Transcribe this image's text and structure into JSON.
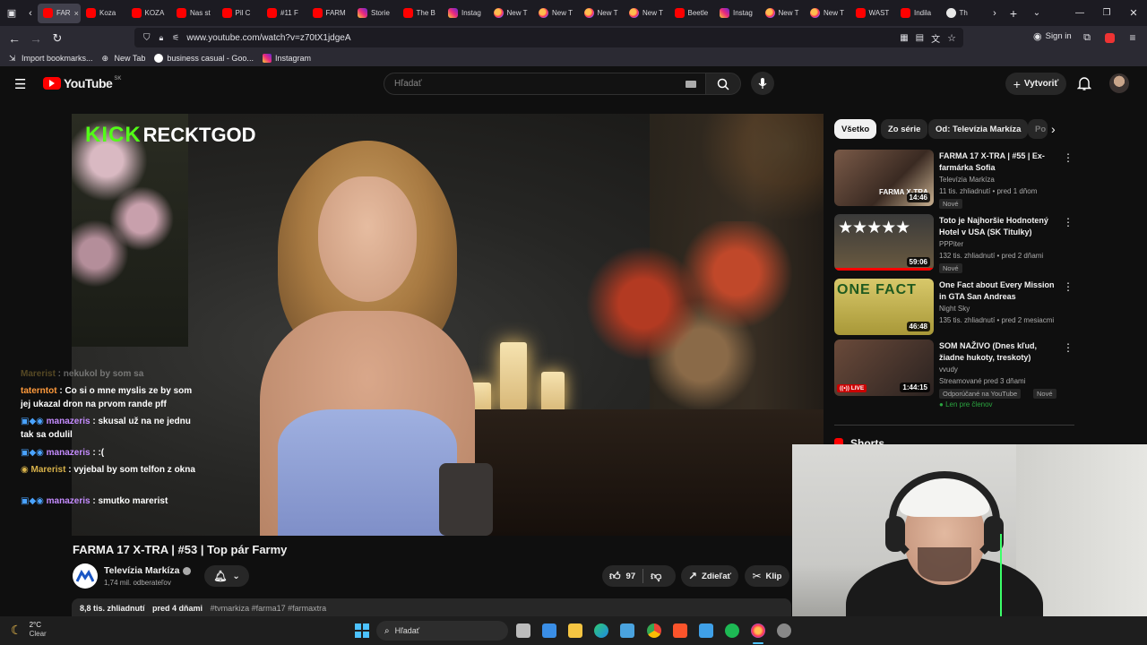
{
  "browser": {
    "tabs": [
      {
        "label": "FAR",
        "favicon": "youtube",
        "active": true
      },
      {
        "label": "Koza",
        "favicon": "youtube"
      },
      {
        "label": "KOZA",
        "favicon": "youtube"
      },
      {
        "label": "Nas st",
        "favicon": "youtube"
      },
      {
        "label": "Pil C",
        "favicon": "youtube"
      },
      {
        "label": "#11 F",
        "favicon": "youtube"
      },
      {
        "label": "FARM",
        "favicon": "youtube"
      },
      {
        "label": "Storie",
        "favicon": "instagram"
      },
      {
        "label": "The B",
        "favicon": "youtube"
      },
      {
        "label": "Instag",
        "favicon": "instagram"
      },
      {
        "label": "New T",
        "favicon": "new-tab"
      },
      {
        "label": "New T",
        "favicon": "new-tab"
      },
      {
        "label": "New T",
        "favicon": "new-tab"
      },
      {
        "label": "New T",
        "favicon": "new-tab"
      },
      {
        "label": "Beetle",
        "favicon": "youtube"
      },
      {
        "label": "Instag",
        "favicon": "instagram"
      },
      {
        "label": "New T",
        "favicon": "new-tab"
      },
      {
        "label": "New T",
        "favicon": "new-tab"
      },
      {
        "label": "WAST",
        "favicon": "youtube"
      },
      {
        "label": "Indila",
        "favicon": "youtube"
      },
      {
        "label": "Th",
        "favicon": "other"
      }
    ],
    "tab_close": "×",
    "url": "www.youtube.com/watch?v=z70tX1jdgeA",
    "sign_in": "Sign in",
    "bookmarks": [
      {
        "label": "Import bookmarks...",
        "icon": "import-icon"
      },
      {
        "label": "New Tab",
        "icon": "globe-icon"
      },
      {
        "label": "business casual - Goo...",
        "icon": "google-icon"
      },
      {
        "label": "Instagram",
        "icon": "instagram-icon"
      }
    ]
  },
  "youtube": {
    "logo_text": "YouTube",
    "region": "SK",
    "search_placeholder": "Hľadať",
    "create_label": "Vytvoriť"
  },
  "video": {
    "kick_logo": "KICK",
    "kick_user": "RECKTGOD",
    "chat": [
      {
        "user": "Marerist",
        "text": "nekukol by som sa",
        "faded": true
      },
      {
        "user": "taterntot",
        "text": "Co si o mne myslis ze by som jej ukazal dron na prvom rande pff"
      },
      {
        "user": "manazeris",
        "text": "skusal už na ne jednu tak sa odulil"
      },
      {
        "user": "manazeris",
        "text": ":("
      },
      {
        "user": "Marerist",
        "text": "vyjebal by som telfon z okna"
      },
      {
        "user": "manazeris",
        "text": "smutko marerist"
      }
    ],
    "title": "FARMA 17 X-TRA | #53 | Top pár Farmy",
    "channel": "Televízia Markíza",
    "subscribers": "1,74 mil. odberateľov",
    "likes": "97",
    "share": "Zdieľať",
    "clip": "Klip",
    "views": "8,8 tis. zhliadnutí",
    "age": "pred 4 dňami",
    "hashtags": "#tvmarkiza #farma17 #farmaxtra"
  },
  "sidebar": {
    "chips": [
      "Všetko",
      "Zo série",
      "Od: Televízia Markíza",
      "Po"
    ],
    "videos": [
      {
        "title": "FARMA 17 X-TRA | #55 | Ex-farmárka Sofia",
        "channel": "Televízia Markíza",
        "stats": "11 tis. zhliadnutí • pred 1 dňom",
        "duration": "14:46",
        "badges": [
          "Nové"
        ],
        "thumb_label": "FARMA X-TRA"
      },
      {
        "title": "Toto je Najhoršie Hodnotený Hotel v USA (SK Titulky)",
        "channel": "PPPiter",
        "stats": "132 tis. zhliadnutí • pred 2 dňami",
        "duration": "59:06",
        "badges": [
          "Nové"
        ],
        "thumb_label": "★★★★★"
      },
      {
        "title": "One Fact about Every Mission in GTA San Andreas",
        "channel": "Night Sky",
        "stats": "135 tis. zhliadnutí • pred 2 mesiacmi",
        "duration": "46:48",
        "badges": [],
        "thumb_label": "ONE FACT"
      },
      {
        "title": "SOM NAŽIVO (Dnes kľud, žiadne hukoty, treskoty)",
        "channel": "vvudy",
        "stats": "Streamované pred 3 dňami",
        "duration": "1:44:15",
        "badges": [
          "Odporúčané na YouTube",
          "Nové"
        ],
        "member": "Len pre členov",
        "live": "LIVE"
      }
    ],
    "shorts_label": "Shorts"
  },
  "taskbar": {
    "weather_temp": "2°C",
    "weather_desc": "Clear",
    "search_placeholder": "Hľadať"
  }
}
